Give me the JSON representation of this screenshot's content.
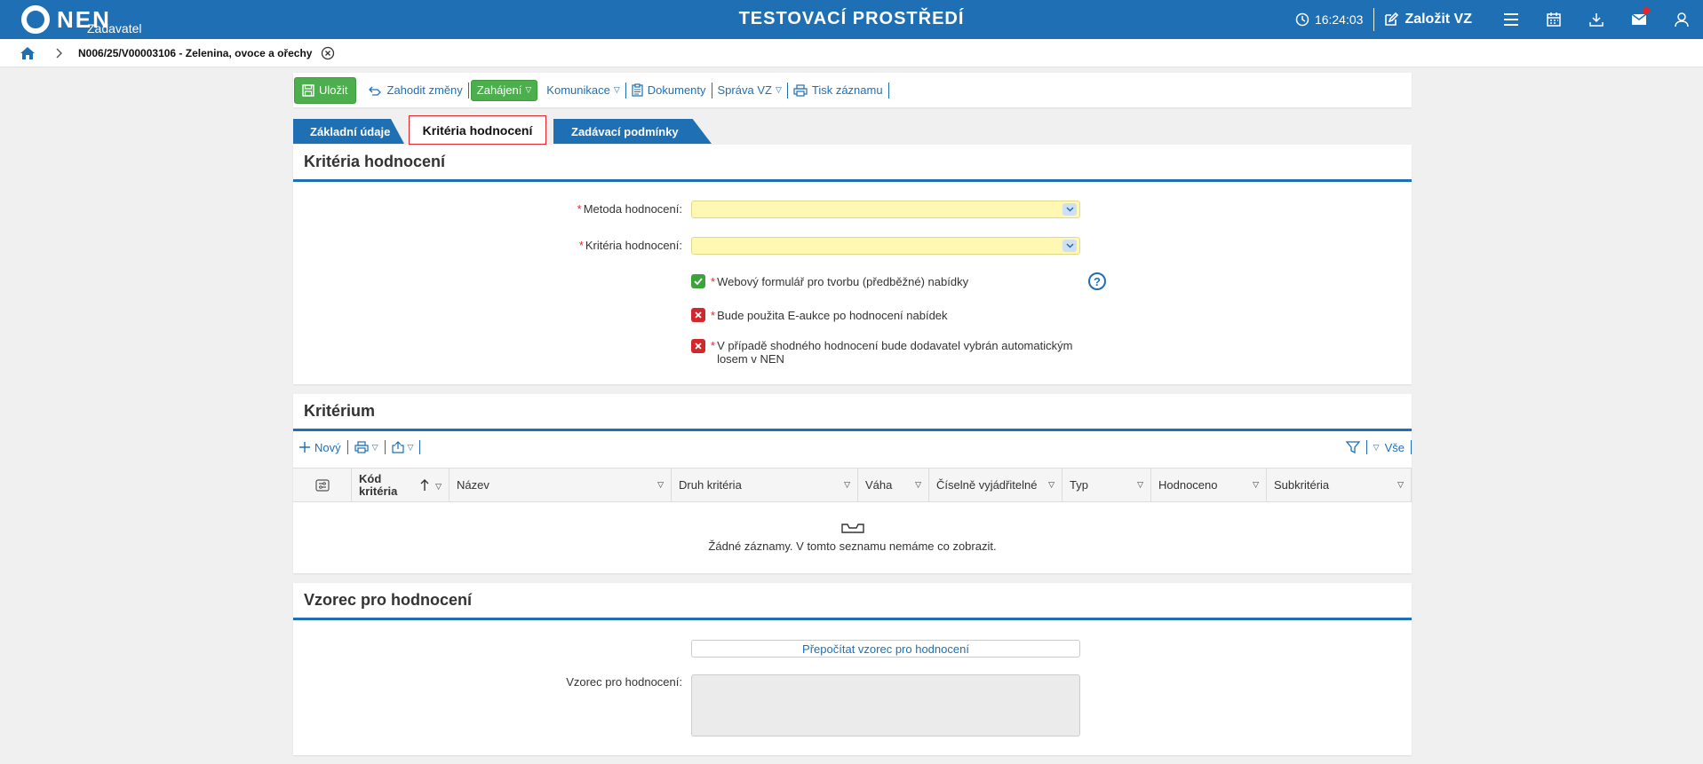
{
  "header": {
    "logo_text": "NEN",
    "logo_sub": "Zadavatel",
    "env_title": "TESTOVACÍ PROSTŘEDÍ",
    "time": "16:24:03",
    "create_label": "Založit VZ",
    "accent": "#1f6fb4"
  },
  "breadcrumb": {
    "text": "N006/25/V00003106 - Zelenina, ovoce a ořechy"
  },
  "toolbar": {
    "save": "Uložit",
    "discard": "Zahodit změny",
    "start": "Zahájení",
    "communication": "Komunikace",
    "documents": "Dokumenty",
    "manage": "Správa VZ",
    "print": "Tisk záznamu"
  },
  "tabs": [
    "Základní údaje",
    "Kritéria hodnocení",
    "Zadávací podmínky"
  ],
  "criteria_panel": {
    "title": "Kritéria hodnocení",
    "method_label": "Metoda hodnocení:",
    "criteria_label": "Kritéria hodnocení:",
    "checks": [
      {
        "label": "Webový formulář pro tvorbu (předběžné) nabídky",
        "state": "checked"
      },
      {
        "label": "Bude použita E-aukce po hodnocení nabídek",
        "state": "unchecked"
      },
      {
        "label": "V případě shodného hodnocení bude dodavatel vybrán automatickým losem v NEN",
        "state": "unchecked"
      }
    ],
    "help": "?"
  },
  "criterion_panel": {
    "title": "Kritérium",
    "new_label": "Nový",
    "all_label": "Vše",
    "columns": [
      "Kód kritéria",
      "Název",
      "Druh kritéria",
      "Váha",
      "Číselně vyjádřitelné",
      "Typ",
      "Hodnoceno",
      "Subkritéria"
    ],
    "empty_text": "Žádné záznamy. V tomto seznamu nemáme co zobrazit."
  },
  "formula_panel": {
    "title": "Vzorec pro hodnocení",
    "recalc_label": "Přepočítat vzorec pro hodnocení",
    "formula_label": "Vzorec pro hodnocení:"
  }
}
